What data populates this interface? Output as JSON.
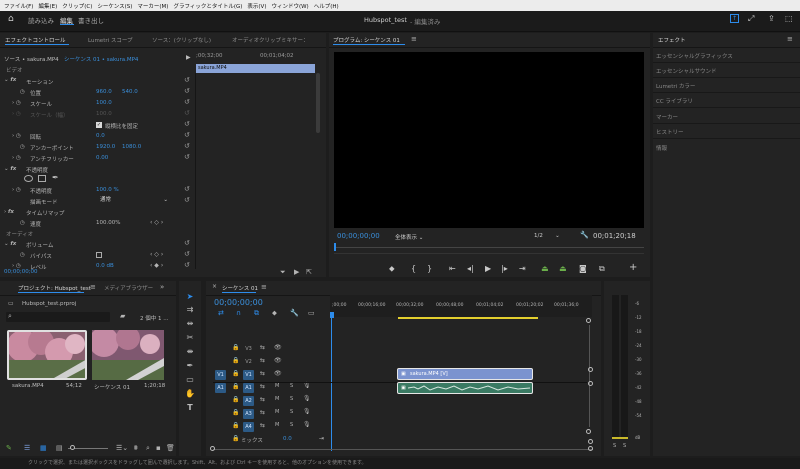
{
  "menu": [
    "ファイル(F)",
    "編集(E)",
    "クリップ(C)",
    "シーケンス(S)",
    "マーカー(M)",
    "グラフィックとタイトル(G)",
    "表示(V)",
    "ウィンドウ(W)",
    "ヘルプ(H)"
  ],
  "topbar": {
    "workspaces": [
      "読み込み",
      "編集",
      "書き出し"
    ],
    "title": "Hubspot_test",
    "subtitle": "- 編集済み"
  },
  "effect_controls": {
    "tabs": [
      "エフェクトコントロール",
      "Lumetri スコープ",
      "ソース：(クリップなし)",
      "オーディオクリップミキサー："
    ],
    "source": "ソース • sakura.MP4",
    "sequence": "シーケンス 01 • sakura.MP4",
    "timecodes": [
      ";00;32;00",
      "00;01;04;02"
    ],
    "mini_clip": "sakura.MP4",
    "video_header": "ビデオ",
    "motion": "モーション",
    "position_label": "位置",
    "position_x": "960.0",
    "position_y": "540.0",
    "scale_label": "スケール",
    "scale_value": "100.0",
    "scale_width_label": "スケール（幅）",
    "scale_width_value": "100.0",
    "uniform_scale_label": "縦横比を固定",
    "rotation_label": "回転",
    "rotation_value": "0.0",
    "anchor_label": "アンカーポイント",
    "anchor_x": "1920.0",
    "anchor_y": "1080.0",
    "flicker_label": "アンチフリッカー",
    "flicker_value": "0.00",
    "opacity_header": "不透明度",
    "opacity_label": "不透明度",
    "opacity_value": "100.0 %",
    "blend_label": "描画モード",
    "blend_value": "通常",
    "time_remap": "タイムリマップ",
    "speed_label": "速度",
    "speed_value": "100.00%",
    "audio_header": "オーディオ",
    "volume": "ボリューム",
    "bypass_label": "バイパス",
    "level_label": "レベル",
    "level_value": "0.0 dB",
    "current_time": "00;00;00;00"
  },
  "program": {
    "title": "プログラム: シーケンス 01",
    "timecode": "00;00;00;00",
    "fit": "全体表示",
    "resolution": "1/2",
    "duration": "00;01;20;18"
  },
  "effects_panel": {
    "title": "エフェクト",
    "items": [
      "エッセンシャルグラフィックス",
      "エッセンシャルサウンド",
      "Lumetri カラー",
      "CC ライブラリ",
      "マーカー",
      "ヒストリー",
      "情報"
    ]
  },
  "project": {
    "tabs": [
      "プロジェクト: Hubspot_test",
      "メディアブラウザー"
    ],
    "file": "Hubspot_test.prproj",
    "count": "2 個中 1 ...",
    "search_placeholder": "",
    "items": [
      {
        "name": "sakura.MP4",
        "duration": "54;12"
      },
      {
        "name": "シーケンス 01",
        "duration": "1;20;18"
      }
    ]
  },
  "timeline": {
    "tab": "シーケンス 01",
    "timecode": "00;00;00;00",
    "ruler": [
      ";00;00",
      "00;00;16;00",
      "00;00;32;00",
      "00;00;48;00",
      "00;01;04;02",
      "00;01;20;02",
      "00;01;36;0"
    ],
    "video_tracks": [
      {
        "label": "V3"
      },
      {
        "label": "V2"
      },
      {
        "label": "V1",
        "source": "V1"
      }
    ],
    "audio_tracks": [
      {
        "label": "A1",
        "source": "A1"
      },
      {
        "label": "A2"
      },
      {
        "label": "A3"
      },
      {
        "label": "A4"
      }
    ],
    "m": "M",
    "s": "S",
    "mix_label": "ミックス",
    "mix_value": "0.0",
    "video_clip": "sakura.MP4 [V]"
  },
  "meter": {
    "labels": [
      "-6",
      "-12",
      "-18",
      "-24",
      "-30",
      "-36",
      "-42",
      "-48",
      "-54",
      "dB"
    ],
    "bottom": [
      "S",
      "S"
    ]
  },
  "status": "クリックで選択、または選択ボックスをドラッグして囲んで選択します。Shift、Alt、および Ctrl キーを使用すると、他のオプションを使用できます。",
  "colors": {
    "accent": "#2d8ceb",
    "clip_blue": "#7b93cf",
    "audio_clip": "#3a7a63",
    "work_area": "#e3cf2e"
  }
}
